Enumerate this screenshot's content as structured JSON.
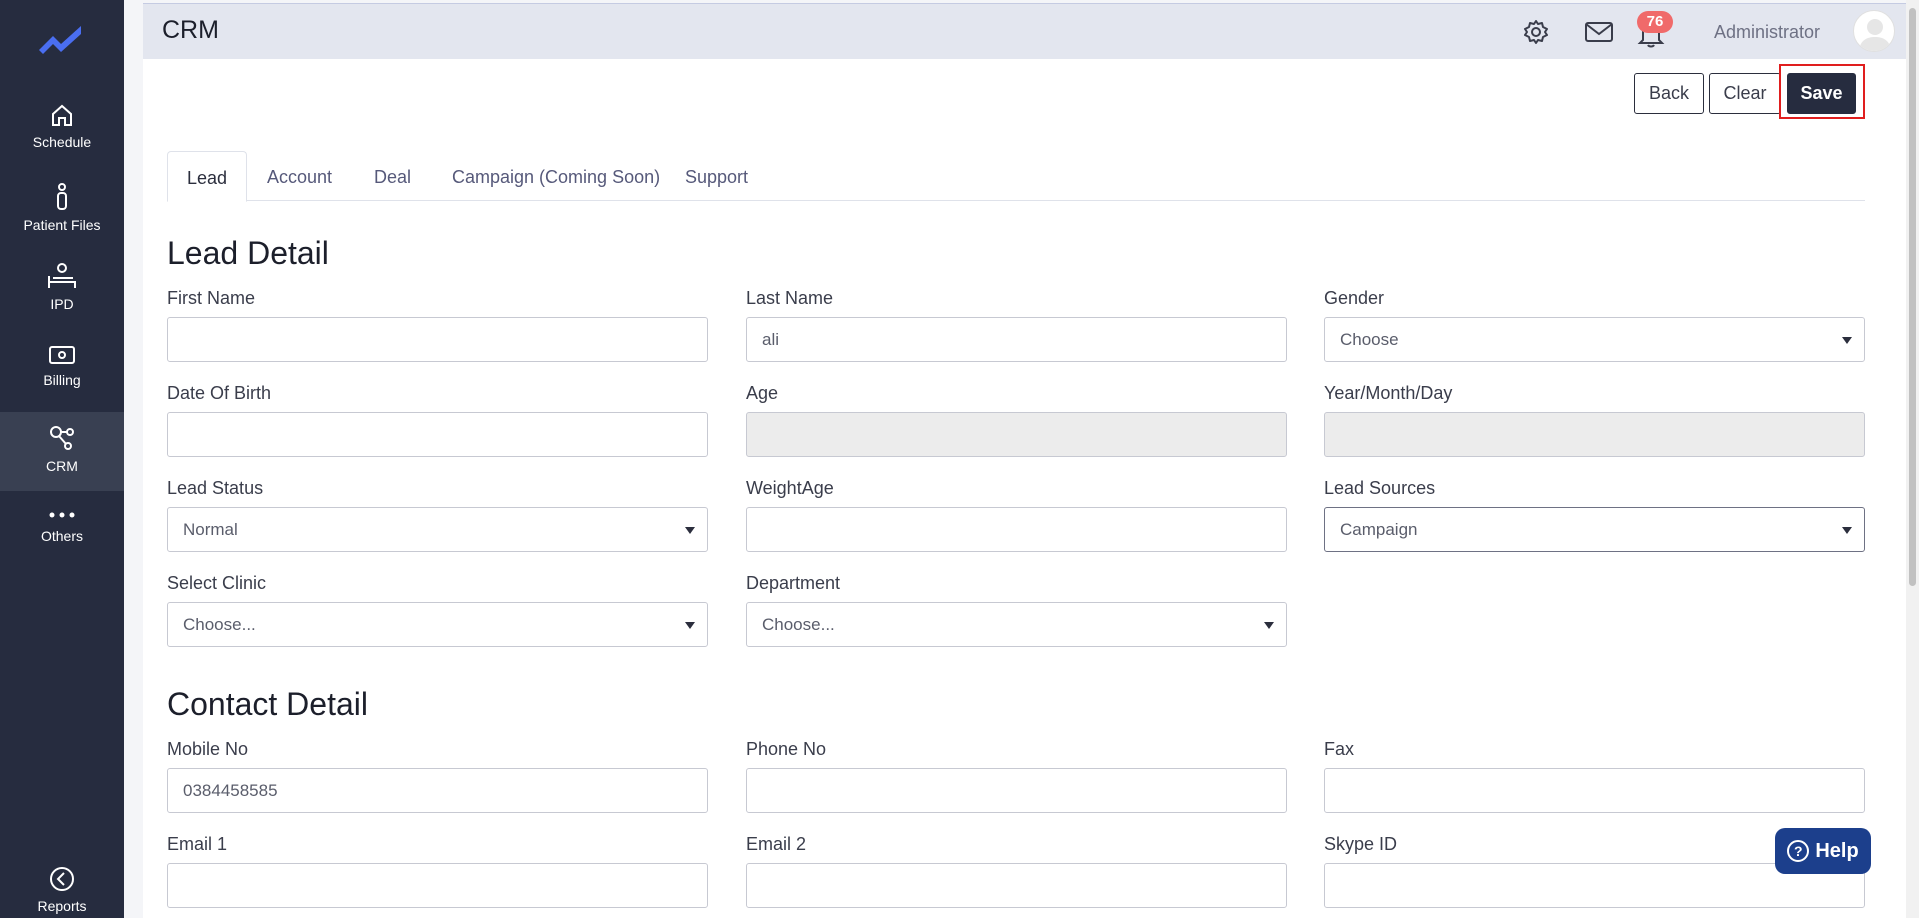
{
  "sidebar": {
    "items": [
      {
        "label": "Schedule",
        "icon": "home-icon"
      },
      {
        "label": "Patient Files",
        "icon": "person-icon"
      },
      {
        "label": "IPD",
        "icon": "bed-icon"
      },
      {
        "label": "Billing",
        "icon": "money-icon"
      },
      {
        "label": "CRM",
        "icon": "share-nodes-icon",
        "active": true
      },
      {
        "label": "Others",
        "icon": "more-dots-icon"
      },
      {
        "label": "Reports",
        "icon": "chevron-left-circle-icon"
      }
    ]
  },
  "topbar": {
    "title": "CRM",
    "notification_count": "76",
    "user_name": "Administrator"
  },
  "actions": {
    "back": "Back",
    "clear": "Clear",
    "save": "Save"
  },
  "tabs": [
    "Lead",
    "Account",
    "Deal",
    "Campaign (Coming Soon)",
    "Support"
  ],
  "lead_detail": {
    "title": "Lead Detail",
    "first_name": {
      "label": "First Name",
      "value": ""
    },
    "last_name": {
      "label": "Last Name",
      "value": "ali"
    },
    "gender": {
      "label": "Gender",
      "value": "Choose"
    },
    "dob": {
      "label": "Date Of Birth",
      "value": ""
    },
    "age": {
      "label": "Age",
      "value": ""
    },
    "ymd": {
      "label": "Year/Month/Day",
      "value": ""
    },
    "lead_status": {
      "label": "Lead Status",
      "value": "Normal"
    },
    "weightage": {
      "label": "WeightAge",
      "value": ""
    },
    "lead_sources": {
      "label": "Lead Sources",
      "value": "Campaign"
    },
    "clinic": {
      "label": "Select Clinic",
      "value": "Choose..."
    },
    "department": {
      "label": "Department",
      "value": "Choose..."
    }
  },
  "contact_detail": {
    "title": "Contact Detail",
    "mobile": {
      "label": "Mobile No",
      "value": "0384458585"
    },
    "phone": {
      "label": "Phone No",
      "value": ""
    },
    "fax": {
      "label": "Fax",
      "value": ""
    },
    "email1": {
      "label": "Email 1",
      "value": ""
    },
    "email2": {
      "label": "Email 2",
      "value": ""
    },
    "skype": {
      "label": "Skype ID",
      "value": ""
    }
  },
  "help": {
    "label": "Help"
  },
  "colors": {
    "sidebar": "#262c3f",
    "sidebar_active": "#394052",
    "badge": "#f06a6a",
    "help": "#1c3f8c",
    "highlight": "#e01e1e"
  }
}
